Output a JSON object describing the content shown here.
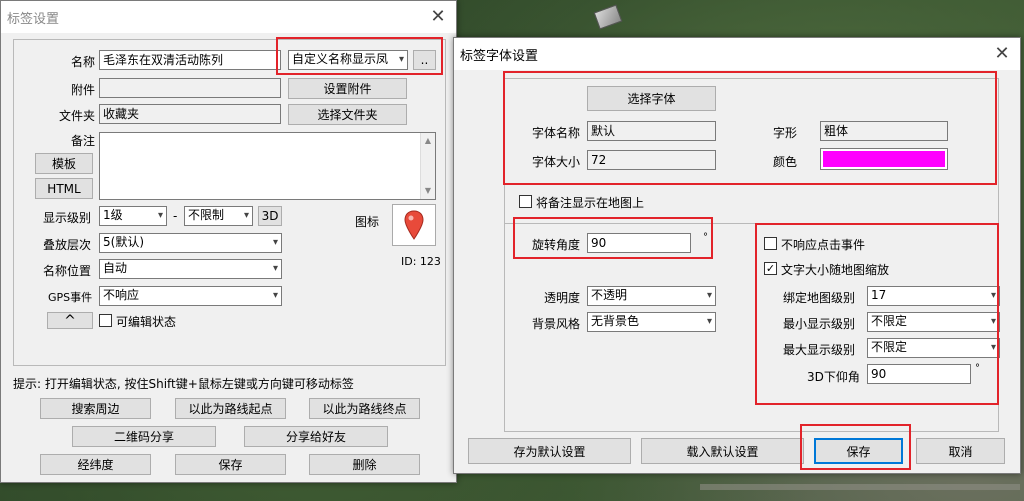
{
  "win1": {
    "title": "标签设置",
    "name_label": "名称",
    "name_value": "毛泽东在双清活动陈列",
    "name_display_select": "自定义名称显示凤",
    "ellipsis_button": "..",
    "attachment_label": "附件",
    "attachment_value": "",
    "set_attachment_button": "设置附件",
    "folder_label": "文件夹",
    "folder_value": "收藏夹",
    "select_folder_button": "选择文件夹",
    "note_label": "备注",
    "template_button": "模板",
    "html_button": "HTML",
    "display_level_label": "显示级别",
    "display_level_min": "1级",
    "dash": "-",
    "display_level_max": "不限制",
    "btn_3d": "3D",
    "icon_label": "图标",
    "id_label": "ID: 123",
    "layer_label": "叠放层次",
    "layer_value": "5(默认)",
    "name_pos_label": "名称位置",
    "name_pos_value": "自动",
    "gps_label": "GPS事件",
    "gps_value": "不响应",
    "collapse_button": "^",
    "editable_label": "可编辑状态",
    "hint": "提示: 打开编辑状态, 按住Shift键+鼠标左键或方向键可移动标签",
    "buttons": {
      "search": "搜索周边",
      "route_start": "以此为路线起点",
      "route_end": "以此为路线终点",
      "qr_share": "二维码分享",
      "share_friend": "分享给好友",
      "latlon": "经纬度",
      "save": "保存",
      "delete": "删除"
    }
  },
  "win2": {
    "title": "标签字体设置",
    "select_font_button": "选择字体",
    "font_name_label": "字体名称",
    "font_name_value": "默认",
    "font_style_label": "字形",
    "font_style_value": "粗体",
    "font_size_label": "字体大小",
    "font_size_value": "72",
    "color_label": "颜色",
    "color_value": "#ff00ff",
    "show_note_label": "将备注显示在地图上",
    "rotation_label": "旋转角度",
    "rotation_value": "90",
    "degree": "°",
    "no_click_label": "不响应点击事件",
    "text_scale_label": "文字大小随地图缩放",
    "opacity_label": "透明度",
    "opacity_value": "不透明",
    "bg_style_label": "背景风格",
    "bg_style_value": "无背景色",
    "bind_level_label": "绑定地图级别",
    "bind_level_value": "17",
    "min_level_label": "最小显示级别",
    "min_level_value": "不限定",
    "max_level_label": "最大显示级别",
    "max_level_value": "不限定",
    "pitch_label": "3D下仰角",
    "pitch_value": "90",
    "save_default_button": "存为默认设置",
    "load_default_button": "载入默认设置",
    "save_button": "保存",
    "cancel_button": "取消"
  },
  "colors": {
    "highlight": "#e2232a",
    "pin": "#e84a3a",
    "font_color": "#ff00ff"
  },
  "icons": {
    "close": "close-icon",
    "dropdown": "chevron-down-icon",
    "pin": "map-pin-icon"
  }
}
